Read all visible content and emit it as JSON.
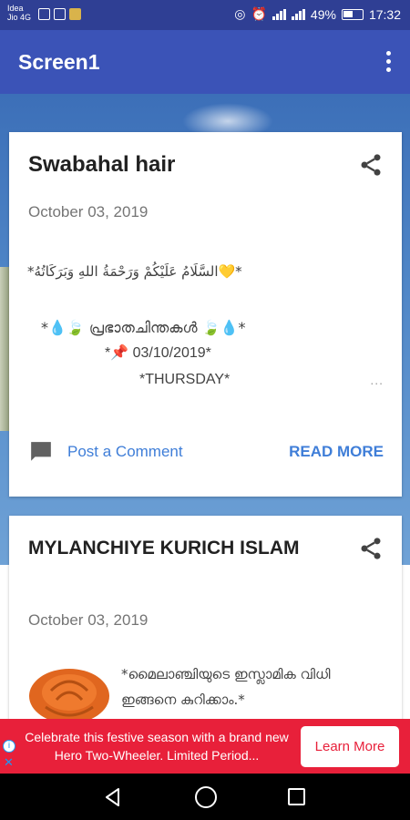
{
  "status_bar": {
    "carrier_line1": "Idea",
    "carrier_line2": "Jio 4G",
    "battery": "49%",
    "time": "17:32"
  },
  "app_bar": {
    "title": "Screen1",
    "menu_icon": "more-vert-icon"
  },
  "posts": [
    {
      "title": "Swabahal hair",
      "date": "October 03, 2019",
      "excerpt": {
        "arabic_line": "*السَّلَامُ عَلَيْكُمْ وَرَحْمَةُ اللهِ وَبَرَكَاتُهُ💛*",
        "malayalam_line": "*💧🍃 പ്രഭാതചിന്തകൾ 🍃💧*",
        "date_line": "*📌 03/10/2019*",
        "day_line": "*THURSDAY*",
        "ellipsis": "..."
      },
      "comment_label": "Post a Comment",
      "read_more_label": "READ MORE"
    },
    {
      "title": "MYLANCHIYE KURICH ISLAM",
      "date": "October 03, 2019",
      "excerpt": {
        "text": "*മൈലാഞ്ചിയുടെ ഇസ്ലാമിക വിധി ഇങ്ങനെ കുറിക്കാം.*"
      }
    }
  ],
  "ad": {
    "text": "Celebrate this festive season with a brand new Hero Two-Wheeler. Limited Period...",
    "button_label": "Learn More",
    "info_label": "i",
    "close_label": "✕",
    "color": "#e8203a"
  },
  "nav_bar": {
    "back_icon": "back-triangle-icon",
    "home_icon": "home-circle-icon",
    "recents_icon": "recents-square-icon"
  },
  "colors": {
    "app_bar": "#3b53b7",
    "status_bar": "#2f3f94",
    "link": "#3f7ed8"
  }
}
